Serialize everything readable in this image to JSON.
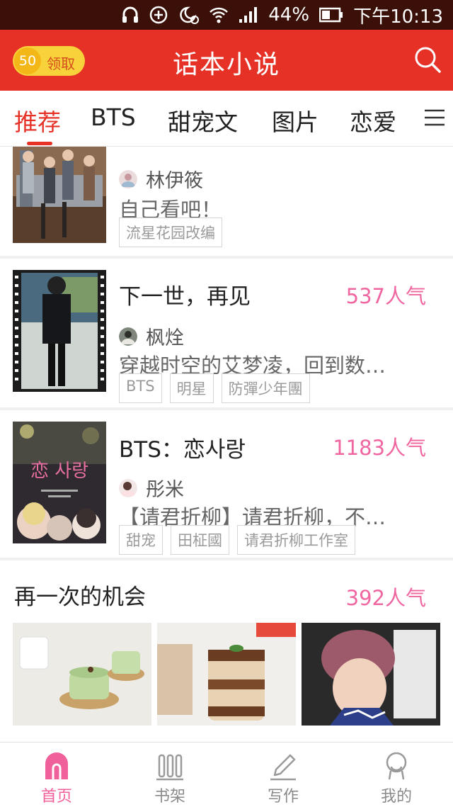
{
  "status": {
    "battery": "44%",
    "time": "下午10:13"
  },
  "header": {
    "coin_count": "50",
    "coin_label": "领取",
    "title": "话本小说"
  },
  "tabs": [
    {
      "label": "推荐"
    },
    {
      "label": "BTS"
    },
    {
      "label": "甜宠文"
    },
    {
      "label": "图片"
    },
    {
      "label": "恋爱"
    }
  ],
  "feed": [
    {
      "author": "林伊筱",
      "description": "自己看吧！",
      "tags": [
        "流星花园改编"
      ]
    },
    {
      "title": "下一世，再见",
      "popularity": "537人气",
      "author": "枫烇",
      "description": "穿越时空的艾梦凌，回到数…",
      "tags": [
        "BTS",
        "明星",
        "防彈少年團"
      ]
    },
    {
      "title": "BTS：恋사랑",
      "popularity": "1183人气",
      "author": "彤米",
      "description": "【请君折柳】请君折柳，不…",
      "tags": [
        "甜宠",
        "田柾國",
        "请君折柳工作室"
      ],
      "cover_text": "恋 사랑"
    },
    {
      "title": "再一次的机会",
      "popularity": "392人气"
    }
  ],
  "bottom_nav": [
    {
      "label": "首页",
      "icon": "home-icon"
    },
    {
      "label": "书架",
      "icon": "bookshelf-icon"
    },
    {
      "label": "写作",
      "icon": "pencil-icon"
    },
    {
      "label": "我的",
      "icon": "profile-icon"
    }
  ],
  "colors": {
    "brand_red": "#e63127",
    "popularity_pink": "#f066a0",
    "status_bar": "#3a1008"
  }
}
